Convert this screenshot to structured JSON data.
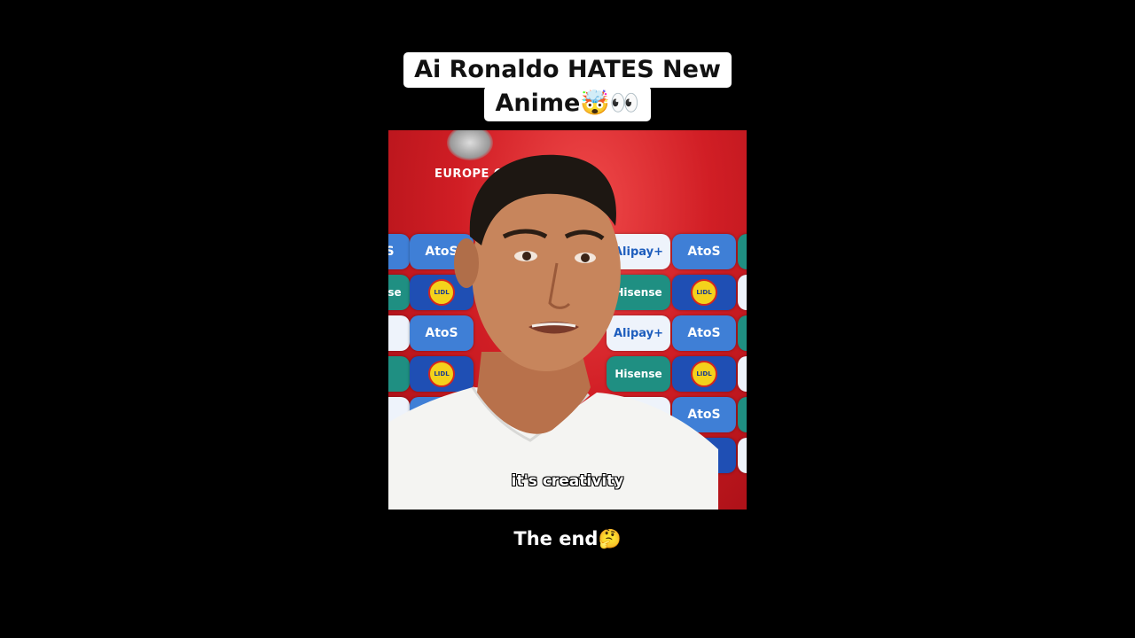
{
  "caption": {
    "line1": "Ai Ronaldo HATES New",
    "line2": "Anime🤯👀"
  },
  "video": {
    "backdrop_text": "EUROPE QUALIF",
    "sponsors": {
      "atos": "AtoS",
      "lidl": "LIDL",
      "hisense": "Hisense",
      "alipay": "Alipay+"
    },
    "subtitle": "it's creativity"
  },
  "footer": {
    "text": "The end🤔"
  }
}
